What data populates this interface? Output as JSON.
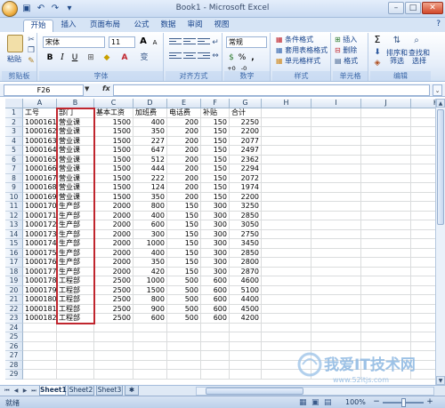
{
  "window": {
    "title": "Book1 - Microsoft Excel",
    "minimize_glyph": "–",
    "maximize_glyph": "□",
    "close_glyph": "✕"
  },
  "qat": {
    "icons": [
      "save-icon",
      "undo-icon",
      "redo-icon",
      "customize-icon"
    ]
  },
  "tabs": [
    "开始",
    "插入",
    "页面布局",
    "公式",
    "数据",
    "审阅",
    "视图"
  ],
  "active_tab": "开始",
  "help_glyph": "?",
  "ribbon": {
    "clipboard": {
      "label": "剪贴板",
      "paste": "粘贴"
    },
    "font": {
      "label": "字体",
      "font_name": "宋体",
      "font_size": "11",
      "bold": "B",
      "italic": "I",
      "underline": "U",
      "grow": "A",
      "shrink": "A",
      "font_color_glyph": "A",
      "wen": "变"
    },
    "alignment": {
      "label": "对齐方式"
    },
    "number": {
      "label": "数字",
      "format": "常规",
      "percent": "%",
      "comma": ",",
      "increase_decimal": "+0",
      "decrease_decimal": "-0",
      "currency": "$"
    },
    "styles": {
      "label": "样式",
      "conditional": "条件格式",
      "table": "套用表格格式",
      "cell_styles": "单元格样式"
    },
    "cells": {
      "label": "单元格",
      "insert": "插入",
      "delete": "删除",
      "format": "格式"
    },
    "editing": {
      "label": "编辑",
      "sigma": "Σ",
      "sort_filter": "排序和筛选",
      "find_select": "查找和选择"
    }
  },
  "formula_bar": {
    "namebox": "F26",
    "fx": "fx",
    "content": ""
  },
  "columns": [
    "A",
    "B",
    "C",
    "D",
    "E",
    "F",
    "G",
    "H",
    "I",
    "J",
    "K"
  ],
  "rows": [
    "1",
    "2",
    "3",
    "4",
    "5",
    "6",
    "7",
    "8",
    "9",
    "10",
    "11",
    "12",
    "13",
    "14",
    "15",
    "16",
    "17",
    "18",
    "19",
    "20",
    "21",
    "22",
    "23",
    "24",
    "25",
    "26",
    "27",
    "28",
    "29"
  ],
  "table": {
    "headers": [
      "工号",
      "部门",
      "基本工资",
      "加班费",
      "电话费",
      "补贴",
      "合计"
    ],
    "rows": [
      [
        "1000161",
        "营业课",
        "1500",
        "400",
        "200",
        "150",
        "2250"
      ],
      [
        "1000162",
        "营业课",
        "1500",
        "350",
        "200",
        "150",
        "2200"
      ],
      [
        "1000163",
        "营业课",
        "1500",
        "227",
        "200",
        "150",
        "2077"
      ],
      [
        "1000164",
        "营业课",
        "1500",
        "647",
        "200",
        "150",
        "2497"
      ],
      [
        "1000165",
        "营业课",
        "1500",
        "512",
        "200",
        "150",
        "2362"
      ],
      [
        "1000166",
        "营业课",
        "1500",
        "444",
        "200",
        "150",
        "2294"
      ],
      [
        "1000167",
        "营业课",
        "1500",
        "222",
        "200",
        "150",
        "2072"
      ],
      [
        "1000168",
        "营业课",
        "1500",
        "124",
        "200",
        "150",
        "1974"
      ],
      [
        "1000169",
        "营业课",
        "1500",
        "350",
        "200",
        "150",
        "2200"
      ],
      [
        "1000170",
        "生产部",
        "2000",
        "800",
        "150",
        "300",
        "3250"
      ],
      [
        "1000171",
        "生产部",
        "2000",
        "400",
        "150",
        "300",
        "2850"
      ],
      [
        "1000172",
        "生产部",
        "2000",
        "600",
        "150",
        "300",
        "3050"
      ],
      [
        "1000173",
        "生产部",
        "2000",
        "300",
        "150",
        "300",
        "2750"
      ],
      [
        "1000174",
        "生产部",
        "2000",
        "1000",
        "150",
        "300",
        "3450"
      ],
      [
        "1000175",
        "生产部",
        "2000",
        "400",
        "150",
        "300",
        "2850"
      ],
      [
        "1000176",
        "生产部",
        "2000",
        "350",
        "150",
        "300",
        "2800"
      ],
      [
        "1000177",
        "生产部",
        "2000",
        "420",
        "150",
        "300",
        "2870"
      ],
      [
        "1000178",
        "工程部",
        "2500",
        "1000",
        "500",
        "600",
        "4600"
      ],
      [
        "1000179",
        "工程部",
        "2500",
        "1500",
        "500",
        "600",
        "5100"
      ],
      [
        "1000180",
        "工程部",
        "2500",
        "800",
        "500",
        "600",
        "4400"
      ],
      [
        "1000181",
        "工程部",
        "2500",
        "900",
        "500",
        "600",
        "4500"
      ],
      [
        "1000182",
        "工程部",
        "2500",
        "600",
        "500",
        "600",
        "4200"
      ]
    ]
  },
  "sheets": [
    "Sheet1",
    "Sheet2",
    "Sheet3"
  ],
  "active_sheet": "Sheet1",
  "status": {
    "text": "就绪",
    "zoom": "100%"
  },
  "watermark": {
    "text": "我爱IT技术网",
    "url": "www.52itjs.com"
  },
  "colors": {
    "highlight": "#c0262e",
    "ribbon_text": "#15428b",
    "accent": "#d2482a"
  }
}
